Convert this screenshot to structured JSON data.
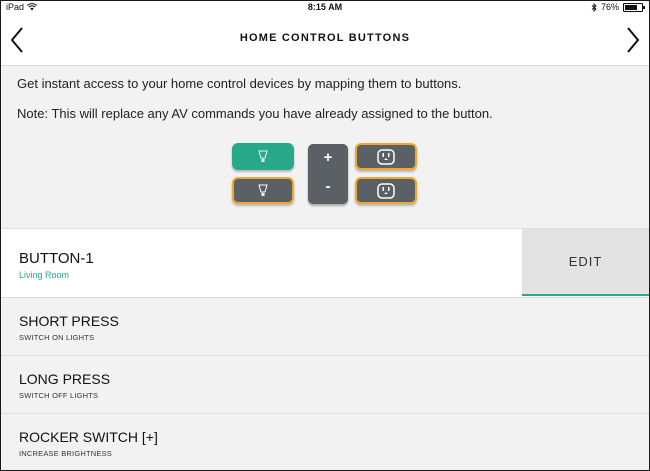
{
  "status_bar": {
    "device": "iPad",
    "time": "8:15 AM",
    "battery": "76%",
    "battery_level": 0.76
  },
  "nav": {
    "title": "HOME CONTROL BUTTONS",
    "back_icon": "chevron-left-icon",
    "forward_icon": "chevron-right-icon"
  },
  "intro": {
    "line1": "Get instant access to your home control devices by mapping them to buttons.",
    "line2": "Note: This will replace any AV commands you have already assigned to the button."
  },
  "diagram": {
    "keys": [
      {
        "icon": "light-bulb-icon",
        "state": "active"
      },
      {
        "icon": "light-bulb-icon",
        "state": "inactive"
      },
      {
        "icon": "power-outlet-icon",
        "state": "inactive"
      },
      {
        "icon": "power-outlet-icon",
        "state": "inactive"
      }
    ],
    "rocker_plus": "+",
    "rocker_minus": "-"
  },
  "button": {
    "name": "BUTTON-1",
    "room": "Living Room",
    "edit_label": "EDIT"
  },
  "actions": [
    {
      "label": "SHORT PRESS",
      "sub": "SWITCH ON LIGHTS"
    },
    {
      "label": "LONG PRESS",
      "sub": "SWITCH OFF LIGHTS"
    },
    {
      "label": "ROCKER SWITCH [+]",
      "sub": "INCREASE BRIGHTNESS"
    }
  ],
  "colors": {
    "accent": "#27a98a",
    "key_border": "#f1a824",
    "key_fill": "#5a6065"
  }
}
